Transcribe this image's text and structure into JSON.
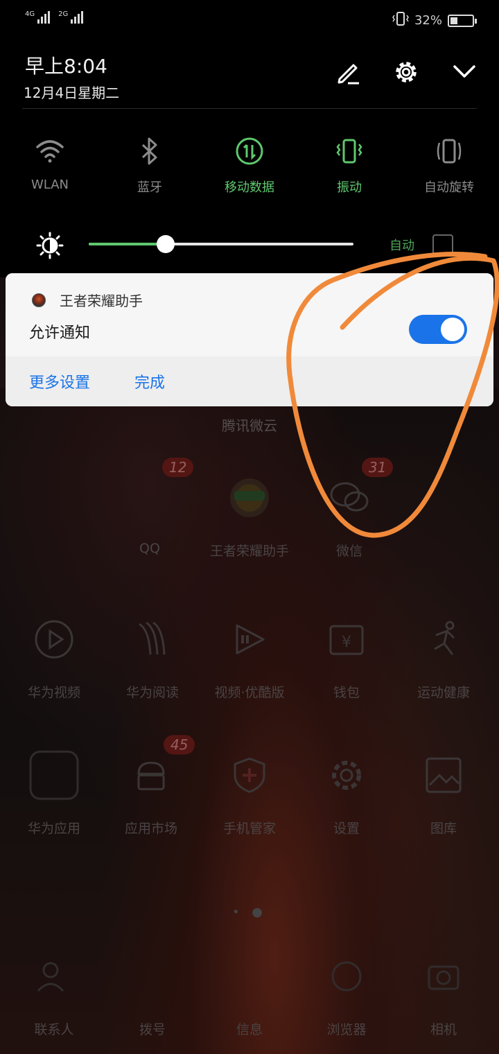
{
  "status_bar": {
    "sim1_type": "4G",
    "sim2_type": "2G",
    "battery_text": "32%",
    "battery_level": 0.32,
    "vibrate_icon": "vibrate-mode-icon"
  },
  "header": {
    "time": "早上8:04",
    "date": "12月4日星期二"
  },
  "quick_toggles": [
    {
      "label": "WLAN",
      "icon": "wifi-icon",
      "active": false
    },
    {
      "label": "蓝牙",
      "icon": "bluetooth-icon",
      "active": false
    },
    {
      "label": "移动数据",
      "icon": "mobile-data-icon",
      "active": true
    },
    {
      "label": "振动",
      "icon": "vibrate-icon",
      "active": true
    },
    {
      "label": "自动旋转",
      "icon": "auto-rotate-icon",
      "active": false
    }
  ],
  "brightness": {
    "level": 0.29,
    "auto_label": "自动",
    "auto_checked": false
  },
  "notification_card": {
    "app_name": "王者荣耀助手",
    "allow_label": "允许通知",
    "allow_enabled": true,
    "more_settings": "更多设置",
    "done": "完成"
  },
  "home": {
    "folder_label": "腾讯微云",
    "row1": [
      {
        "label": "QQ",
        "badge": "12"
      },
      {
        "label": "王者荣耀助手",
        "badge": ""
      },
      {
        "label": "微信",
        "badge": "31"
      }
    ],
    "row2": [
      {
        "label": "华为视频"
      },
      {
        "label": "华为阅读"
      },
      {
        "label": "视频·优酷版"
      },
      {
        "label": "钱包"
      },
      {
        "label": "运动健康"
      }
    ],
    "row3": [
      {
        "label": "华为应用",
        "badge": ""
      },
      {
        "label": "应用市场",
        "badge": "45"
      },
      {
        "label": "手机管家",
        "badge": ""
      },
      {
        "label": "设置",
        "badge": ""
      },
      {
        "label": "图库",
        "badge": ""
      }
    ],
    "dock": [
      {
        "label": "联系人"
      },
      {
        "label": "拨号"
      },
      {
        "label": "信息"
      },
      {
        "label": "浏览器"
      },
      {
        "label": "相机"
      }
    ]
  },
  "colors": {
    "accent_green": "#5fc86e",
    "accent_blue": "#1a73e8",
    "annotation_orange": "#f08a3a"
  }
}
